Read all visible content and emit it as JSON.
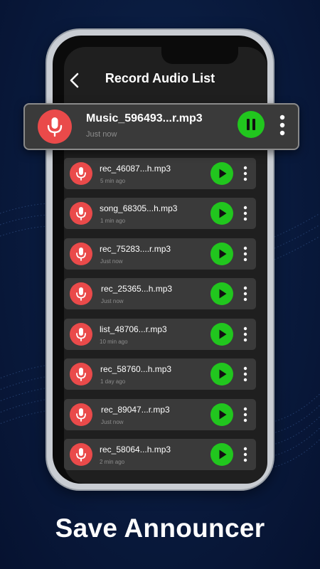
{
  "header": {
    "title": "Record Audio List",
    "back_icon": "chevron-left-icon"
  },
  "featured": {
    "name": "Music_596493...r.mp3",
    "time": "Just now",
    "action_icon": "pause-icon"
  },
  "recordings": [
    {
      "name": "rec_46087...h.mp3",
      "time": "5 min ago"
    },
    {
      "name": "song_68305...h.mp3",
      "time": "1 min ago"
    },
    {
      "name": "rec_75283....r.mp3",
      "time": "Just now"
    },
    {
      "name": "rec_25365...h.mp3",
      "time": "Just now"
    },
    {
      "name": "list_48706...r.mp3",
      "time": "10 min ago"
    },
    {
      "name": "rec_58760...h.mp3",
      "time": "1 day ago"
    },
    {
      "name": "rec_89047...r.mp3",
      "time": "Just now"
    },
    {
      "name": "rec_58064...h.mp3",
      "time": "2 min ago"
    }
  ],
  "caption": "Save Announcer",
  "colors": {
    "accent_green": "#21c61e",
    "mic_red": "#ea4a4a",
    "row_bg": "#3a3a3a",
    "screen_bg": "#1f1f1f"
  }
}
